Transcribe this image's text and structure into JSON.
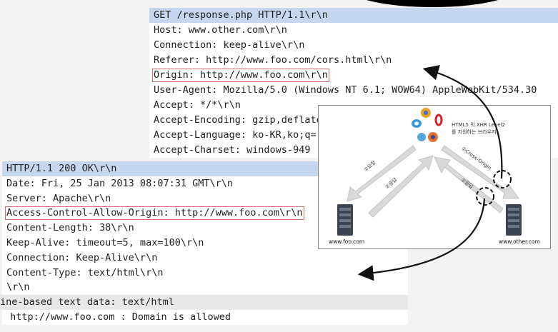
{
  "request": {
    "lines": [
      "GET /response.php HTTP/1.1\\r\\n",
      "Host: www.other.com\\r\\n",
      "Connection: keep-alive\\r\\n",
      "Referer: http://www.foo.com/cors.html\\r\\n",
      "Origin: http://www.foo.com\\r\\n",
      "User-Agent: Mozilla/5.0 (Windows NT 6.1; WOW64) AppleWebKit/534.30",
      "Accept: */*\\r\\n",
      "Accept-Encoding: gzip,deflate",
      "Accept-Language: ko-KR,ko;q=",
      "Accept-Charset: windows-949"
    ]
  },
  "response": {
    "lines": [
      "HTTP/1.1 200 OK\\r\\n",
      "Date: Fri, 25 Jan 2013 08:07:31 GMT\\r\\n",
      "Server: Apache\\r\\n",
      "Access-Control-Allow-Origin: http://www.foo.com\\r\\n",
      "Content-Length: 38\\r\\n",
      "Keep-Alive: timeout=5, max=100\\r\\n",
      "Connection: Keep-Alive\\r\\n",
      "Content-Type: text/html\\r\\n",
      "\\r\\n"
    ],
    "section_label": "ine-based text data: text/html",
    "body_text": " http://www.foo.com : Domain is allowed"
  },
  "diagram": {
    "browser_caption_1": "HTML5 의 XHR Level2",
    "browser_caption_2": "를 지원하는 브라우저",
    "left_arrow_down_label": "①요청",
    "left_arrow_up_label": "②응답",
    "right_arrow_label_1": "①Cross-Origin",
    "right_arrow_label_2": "②응답",
    "left_server_label": "www.foo.com",
    "right_server_label": "www.other.com"
  },
  "colors": {
    "selected_row": "#c5d7ee",
    "highlight_box": "#d06a6a"
  }
}
